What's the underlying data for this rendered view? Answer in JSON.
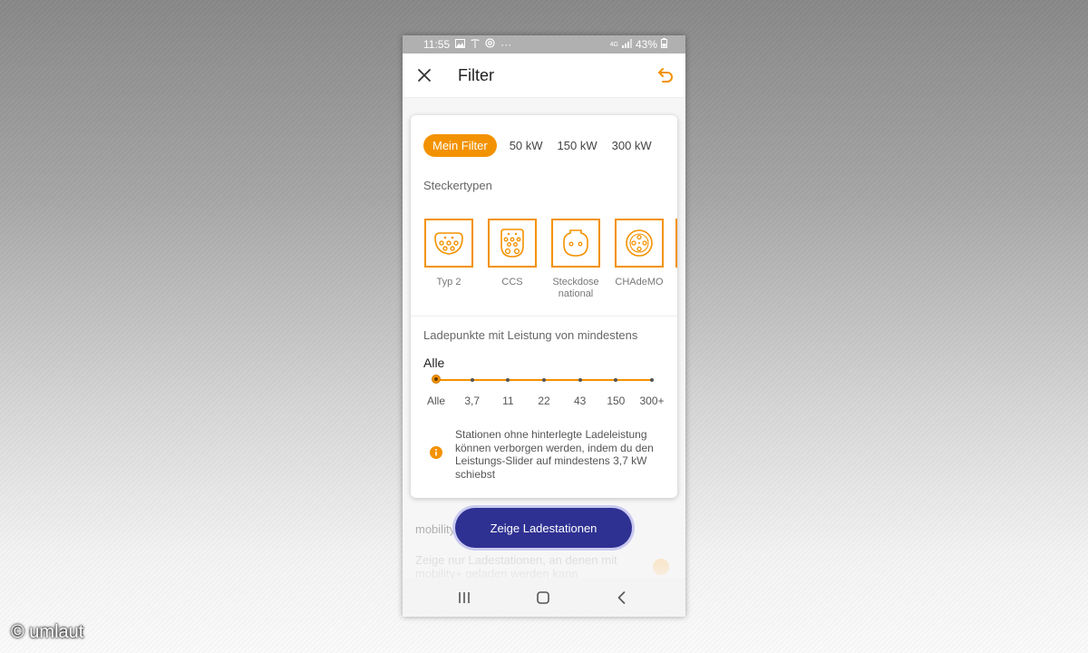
{
  "status_bar": {
    "time": "11:55",
    "dots": "···",
    "network": "4G",
    "battery": "43%"
  },
  "app_bar": {
    "title": "Filter",
    "close_icon": "close-icon",
    "undo_icon": "undo-icon"
  },
  "presets": [
    {
      "label": "Mein Filter",
      "active": true
    },
    {
      "label": "50 kW",
      "active": false
    },
    {
      "label": "150 kW",
      "active": false
    },
    {
      "label": "300 kW",
      "active": false
    }
  ],
  "plug_types": {
    "title": "Steckertypen",
    "items": [
      {
        "label": "Typ 2",
        "icon": "type2-plug-icon"
      },
      {
        "label": "CCS",
        "icon": "ccs-plug-icon"
      },
      {
        "label": "Steckdose national",
        "icon": "schuko-plug-icon"
      },
      {
        "label": "CHAdeMO",
        "icon": "chademo-plug-icon"
      }
    ]
  },
  "power": {
    "title": "Ladepunkte mit Leistung von mindestens",
    "selected_value": "Alle",
    "slider_position": 0,
    "ticks": [
      "Alle",
      "3,7",
      "11",
      "22",
      "43",
      "150",
      "300+"
    ],
    "info_text": "Stationen ohne hinterlegte Ladeleistung können verborgen werden, indem du den Leistungs-Slider auf mindestens 3,7 kW schiebst"
  },
  "behind": {
    "title": "mobility",
    "text": "Zeige nur Ladestationen, an denen mit mobility+ geladen werden kann"
  },
  "cta_label": "Zeige Ladestationen",
  "nav": {
    "recent_icon": "recent-apps-icon",
    "home_icon": "home-icon",
    "back_icon": "back-icon"
  },
  "watermark": "© umlaut",
  "colors": {
    "accent": "#f39200",
    "cta": "#2e3192",
    "status_bar": "#b0b0b0"
  }
}
